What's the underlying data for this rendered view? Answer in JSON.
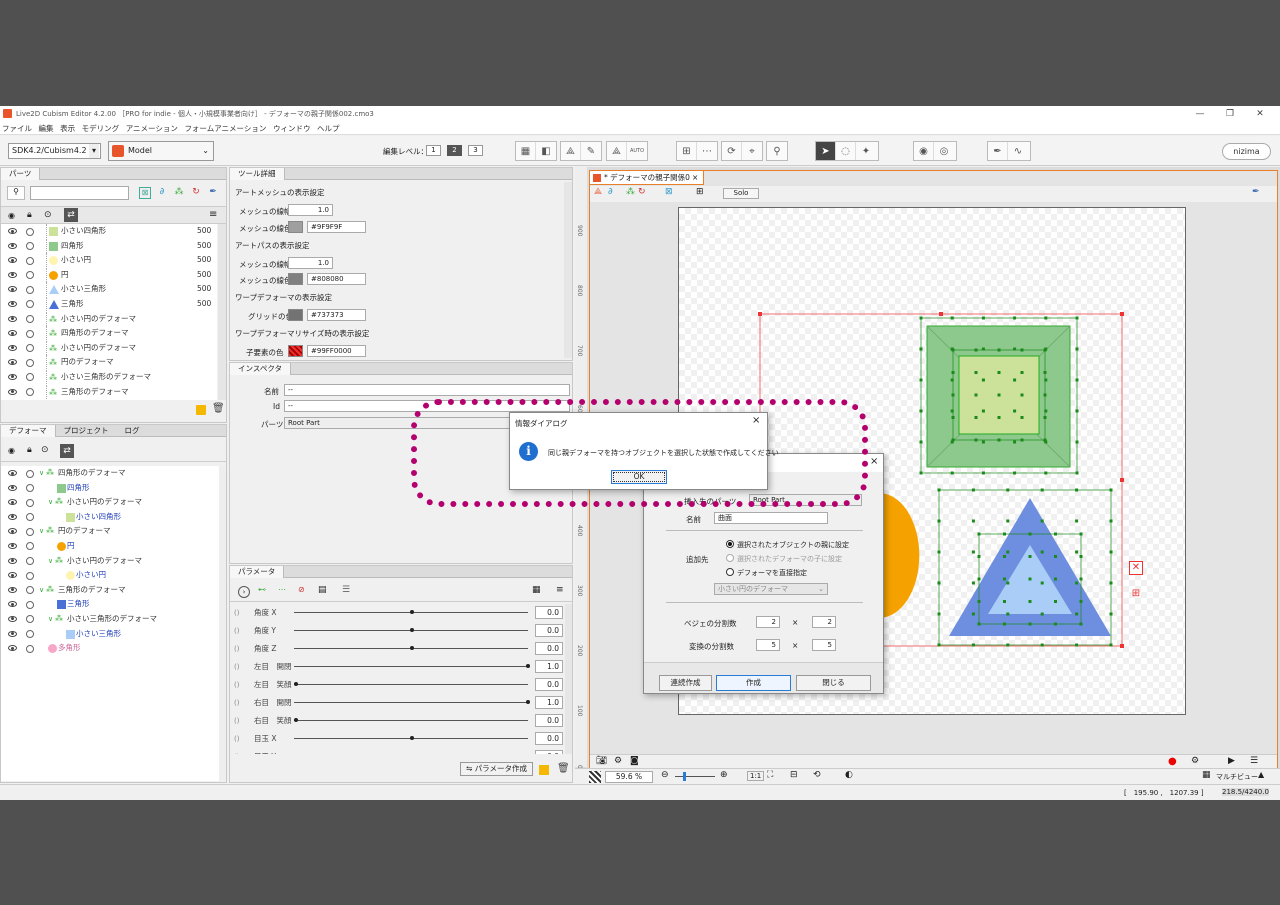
{
  "window": {
    "title": "Live2D Cubism Editor 4.2.00 ［PRO for indie - 個人・小規模事業者向け］ - デフォーマの親子関係002.cmo3",
    "controls": [
      "—",
      "❐",
      "✕"
    ]
  },
  "menu": [
    "ファイル",
    "編集",
    "表示",
    "モデリング",
    "アニメーション",
    "フォームアニメーション",
    "ウィンドウ",
    "ヘルプ"
  ],
  "toolbar": {
    "sdk_select": "SDK4.2/Cubism4.2",
    "model_select": "Model",
    "edit_level_label": "編集レベル：",
    "edit_levels": [
      "1",
      "2",
      "3"
    ],
    "auto_label": "AUTO",
    "nizima": "nizima"
  },
  "parts_panel": {
    "tab": "パーツ",
    "items": [
      {
        "label": "小さい四角形",
        "value": "500",
        "icon": "light-green-square"
      },
      {
        "label": "四角形",
        "value": "500",
        "icon": "green-square"
      },
      {
        "label": "小さい円",
        "value": "500",
        "icon": "light-yellow-circle"
      },
      {
        "label": "円",
        "value": "500",
        "icon": "orange-circle"
      },
      {
        "label": "小さい三角形",
        "value": "500",
        "icon": "light-blue-triangle"
      },
      {
        "label": "三角形",
        "value": "500",
        "icon": "blue-triangle"
      },
      {
        "label": "小さい円のデフォーマ",
        "value": "",
        "icon": "warp-icon"
      },
      {
        "label": "四角形のデフォーマ",
        "value": "",
        "icon": "warp-icon"
      },
      {
        "label": "小さい円のデフォーマ",
        "value": "",
        "icon": "warp-icon"
      },
      {
        "label": "円のデフォーマ",
        "value": "",
        "icon": "warp-icon"
      },
      {
        "label": "小さい三角形のデフォーマ",
        "value": "",
        "icon": "warp-icon"
      },
      {
        "label": "三角形のデフォーマ",
        "value": "",
        "icon": "warp-icon"
      }
    ]
  },
  "deformer_panel": {
    "tabs": [
      "デフォーマ",
      "プロジェクト",
      "ログ"
    ],
    "items": [
      {
        "label": "四角形のデフォーマ",
        "indent": 0,
        "type": "warp"
      },
      {
        "label": "四角形",
        "indent": 1,
        "type": "mesh-green"
      },
      {
        "label": "小さい円のデフォーマ",
        "indent": 1,
        "type": "warp"
      },
      {
        "label": "小さい四角形",
        "indent": 2,
        "type": "mesh-lightgreen"
      },
      {
        "label": "円のデフォーマ",
        "indent": 0,
        "type": "warp"
      },
      {
        "label": "円",
        "indent": 1,
        "type": "mesh-orange"
      },
      {
        "label": "小さい円のデフォーマ",
        "indent": 1,
        "type": "warp"
      },
      {
        "label": "小さい円",
        "indent": 2,
        "type": "mesh-yellow"
      },
      {
        "label": "三角形のデフォーマ",
        "indent": 0,
        "type": "warp"
      },
      {
        "label": "三角形",
        "indent": 1,
        "type": "mesh-blue"
      },
      {
        "label": "小さい三角形のデフォーマ",
        "indent": 1,
        "type": "warp"
      },
      {
        "label": "小さい三角形",
        "indent": 2,
        "type": "mesh-lightblue"
      },
      {
        "label": "多角形",
        "indent": 0,
        "type": "mesh-pink"
      }
    ]
  },
  "tool_detail": {
    "tab": "ツール詳細",
    "sections": [
      {
        "title": "アートメッシュの表示設定",
        "rows": [
          {
            "label": "メッシュの線幅",
            "value": "1.0"
          },
          {
            "label": "メッシュの線色",
            "color": "#9F9F9F",
            "value": "#9F9F9F"
          }
        ]
      },
      {
        "title": "アートパスの表示設定",
        "rows": [
          {
            "label": "メッシュの線幅",
            "value": "1.0"
          },
          {
            "label": "メッシュの線色",
            "color": "#808080",
            "value": "#808080"
          }
        ]
      },
      {
        "title": "ワープデフォーマの表示設定",
        "rows": [
          {
            "label": "グリッドの色",
            "color": "#737373",
            "value": "#737373"
          }
        ]
      },
      {
        "title": "ワープデフォーマリサイズ時の表示設定",
        "rows": [
          {
            "label": "子要素の色",
            "color": "#FF0000",
            "value": "#99FF0000"
          }
        ]
      }
    ]
  },
  "inspector": {
    "tab": "インスペクタ",
    "name_label": "名前",
    "name_value": "--",
    "id_label": "Id",
    "id_value": "--",
    "part_label": "パーツ",
    "part_value": "Root Part"
  },
  "parameters": {
    "tab": "パラメータ",
    "items": [
      {
        "label": "角度 X",
        "value": "0.0",
        "pos": 0.5
      },
      {
        "label": "角度 Y",
        "value": "0.0",
        "pos": 0.5
      },
      {
        "label": "角度 Z",
        "value": "0.0",
        "pos": 0.5
      },
      {
        "label": "左目　開閉",
        "value": "1.0",
        "pos": 1.0
      },
      {
        "label": "左目　笑顔",
        "value": "0.0",
        "pos": 0.0
      },
      {
        "label": "右目　開閉",
        "value": "1.0",
        "pos": 1.0
      },
      {
        "label": "右目　笑顔",
        "value": "0.0",
        "pos": 0.0
      },
      {
        "label": "目玉 X",
        "value": "0.0",
        "pos": 0.5
      },
      {
        "label": "目玉 Y",
        "value": "0.0",
        "pos": 0.5
      }
    ],
    "create_button": "パラメータ作成"
  },
  "viewport": {
    "tab": "* デフォーマの親子関係0",
    "solo": "Solo",
    "ruler_marks": [
      "900",
      "800",
      "700",
      "600",
      "500",
      "400",
      "300",
      "200",
      "100",
      "0"
    ],
    "zoom": "59.6 %",
    "one_to_one": "1:1",
    "menu": "マルチビュー"
  },
  "info_dialog": {
    "title": "情報ダイアログ",
    "message": "同じ親デフォーマを持つオブジェクトを選択した状態で作成してください",
    "ok": "OK"
  },
  "create_dialog": {
    "insert_label": "挿入先のパーツ",
    "insert_value": "Root Part",
    "name_label": "名前",
    "name_value": "曲面",
    "target_label": "追加先",
    "radio1": "選択されたオブジェクトの親に設定",
    "radio2": "選択されたデフォーマの子に設定",
    "radio3": "デフォーマを直接指定",
    "target_select": "小さい円のデフォーマ",
    "bezier_label": "ベジェの分割数",
    "bezier_x": "2",
    "bezier_y": "2",
    "transform_label": "変換の分割数",
    "transform_x": "5",
    "transform_y": "5",
    "times": "×",
    "btn_continuous": "連続作成",
    "btn_create": "作成",
    "btn_close": "閉じる"
  },
  "statusbar": {
    "coords": "[　195.90 ,　1207.39 ]",
    "zoom_info": "218.5/4240.0"
  },
  "colors": {
    "highlight_dots": "#b4006e",
    "green_square": "#8dc88d",
    "inner_square": "#cce29b",
    "orange": "#f5a200",
    "blue_triangle": "#6e8ee0",
    "light_blue": "#a9cdf7",
    "viewport_border": "#e87f2a"
  }
}
